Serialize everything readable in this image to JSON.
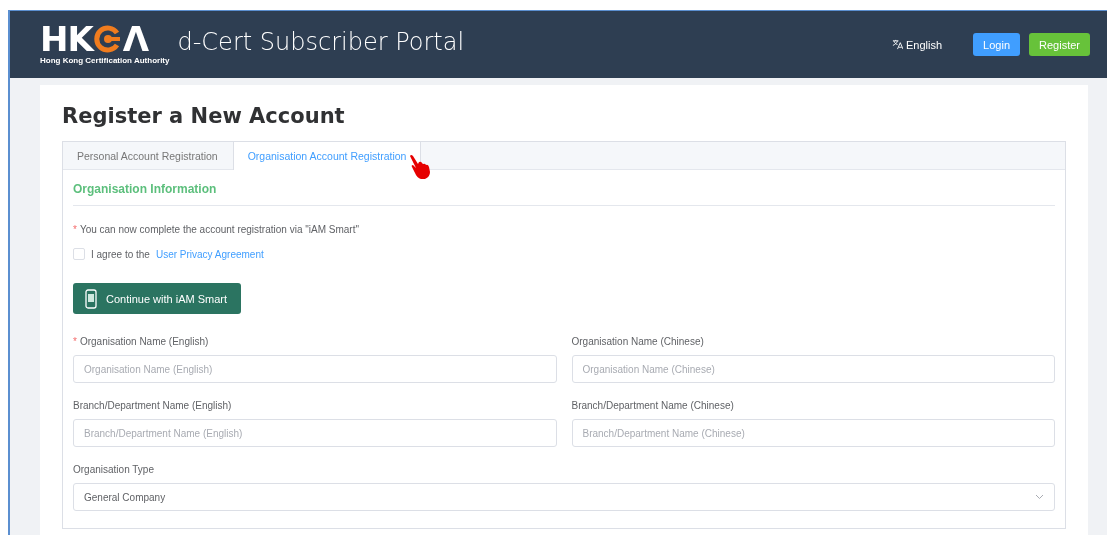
{
  "header": {
    "logo": {
      "left": "HK",
      "right": "Λ",
      "subtitle": "Hong Kong Certification Authority"
    },
    "title": "d-Cert Subscriber Portal",
    "language": "English",
    "buttons": [
      {
        "label": "Login",
        "kind": "primary"
      },
      {
        "label": "Register",
        "kind": "success"
      }
    ]
  },
  "page": {
    "title": "Register a New Account",
    "tabs": [
      {
        "label": "Personal Account Registration",
        "selected": false
      },
      {
        "label": "Organisation Account Registration",
        "selected": true
      }
    ],
    "section_title": "Organisation Information",
    "notice": {
      "mark": "*",
      "text": "You can now complete the account registration via \"iAM Smart\""
    },
    "agreement": {
      "checked": false,
      "text": "I agree to the",
      "link": "User Privacy Agreement"
    },
    "iam_button": "Continue with iAM Smart",
    "fields": [
      {
        "kind": "input",
        "label": "Organisation Name (English)",
        "mark": "*",
        "placeholder": "Organisation Name (English)"
      },
      {
        "kind": "input",
        "label": "Organisation Name (Chinese)",
        "placeholder": "Organisation Name (Chinese)"
      },
      {
        "kind": "input",
        "label": "Branch/Department Name (English)",
        "placeholder": "Branch/Department Name (English)"
      },
      {
        "kind": "input",
        "label": "Branch/Department Name (Chinese)",
        "placeholder": "Branch/Department Name (Chinese)"
      },
      {
        "kind": "select",
        "label": "Organisation Type",
        "value": "General Company"
      }
    ]
  }
}
